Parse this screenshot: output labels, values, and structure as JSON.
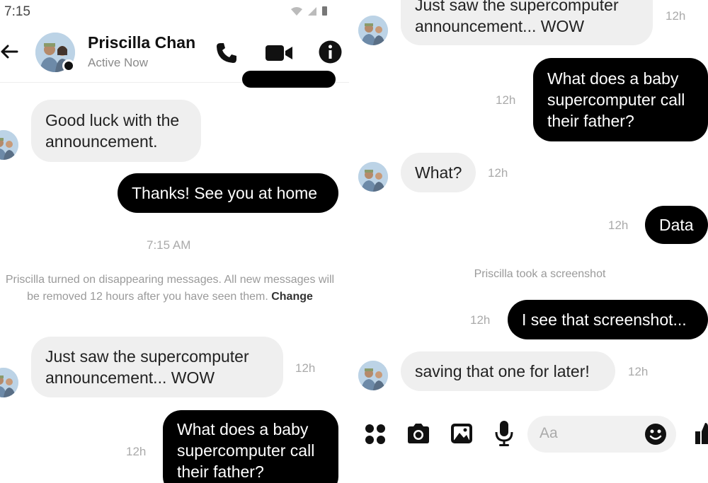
{
  "status": {
    "time": "7:15"
  },
  "header": {
    "contact_name": "Priscilla Chan",
    "contact_status": "Active Now"
  },
  "left": {
    "msg1": "Good luck with the announcement.",
    "msg2": "Thanks! See you at home",
    "divider_time": "7:15 AM",
    "notice_text": "Priscilla turned on disappearing messages. All new messages will be removed 12 hours after you have seen them.",
    "notice_link": "Change",
    "msg3": "Just saw the supercomputer announcement... WOW",
    "msg3_time": "12h",
    "msg4": "What does a baby supercomputer call their father?",
    "msg4_time": "12h"
  },
  "right": {
    "msg1": "Just saw the supercomputer announcement... WOW",
    "msg1_time": "12h",
    "msg2": "What does a baby supercomputer call their father?",
    "msg2_time": "12h",
    "msg3": "What?",
    "msg3_time": "12h",
    "msg4": "Data",
    "msg4_time": "12h",
    "notice": "Priscilla took a screenshot",
    "msg5": "I see that screenshot...",
    "msg5_time": "12h",
    "msg6": "saving that one for later!",
    "msg6_time": "12h"
  },
  "composer": {
    "placeholder": "Aa"
  },
  "icons": [
    "back-arrow-icon",
    "phone-icon",
    "video-camera-icon",
    "info-icon",
    "apps-grid-icon",
    "camera-icon",
    "gallery-icon",
    "microphone-icon",
    "emoji-icon",
    "thumbs-up-icon",
    "wifi-icon",
    "signal-icon",
    "battery-icon"
  ]
}
